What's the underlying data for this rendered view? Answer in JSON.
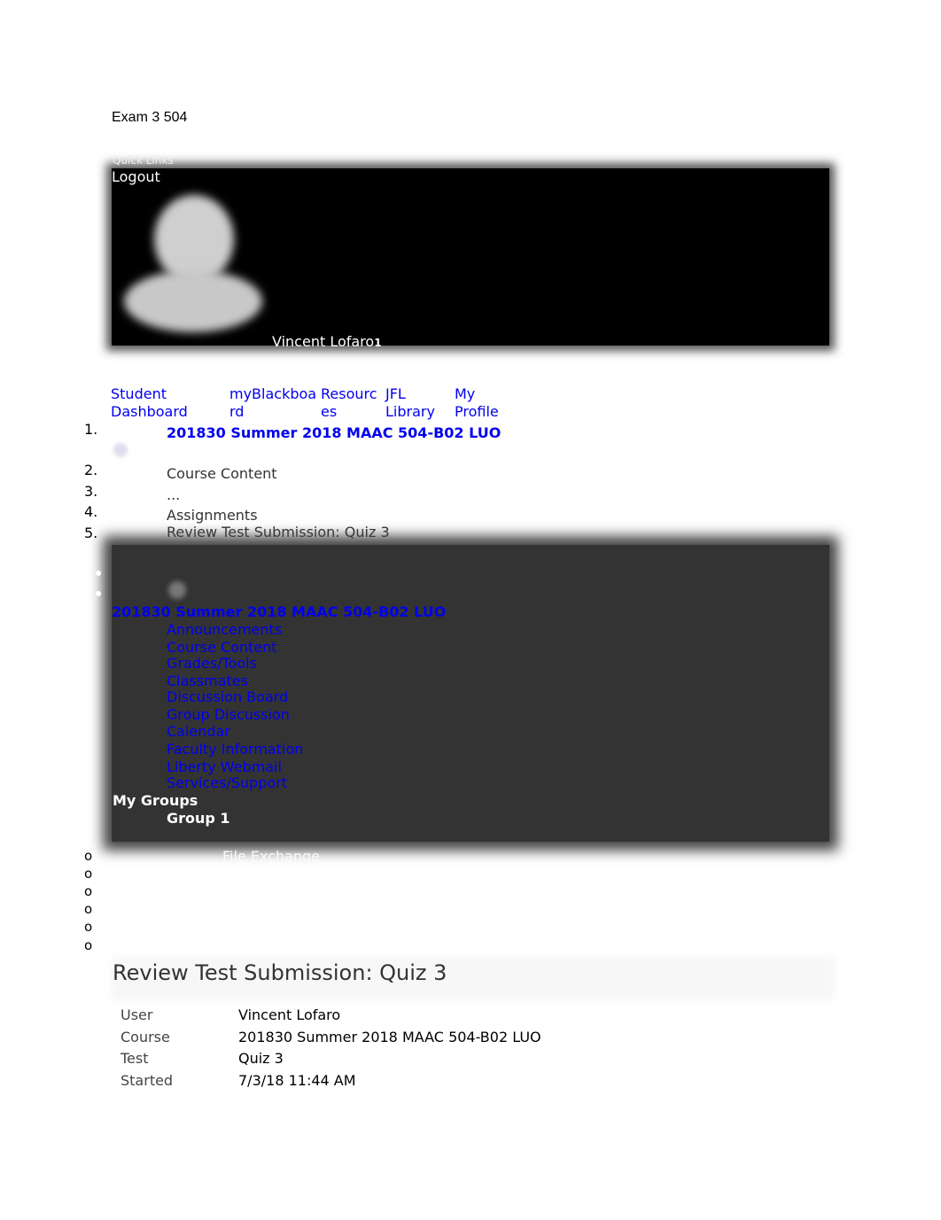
{
  "doc_title": "Exam 3 504",
  "header": {
    "quick_links": "Quick Links",
    "logout": "Logout",
    "user_name": "Vincent Lofaro",
    "notification_count": "1"
  },
  "nav_tabs": [
    {
      "line1": "Student",
      "line2": "Dashboard"
    },
    {
      "line1": "myBlackboa",
      "line2": "rd"
    },
    {
      "line1": "Resourc",
      "line2": "es"
    },
    {
      "line1": "JFL",
      "line2": "Library"
    },
    {
      "line1": "My",
      "line2": "Profile"
    }
  ],
  "breadcrumb": {
    "numbers": [
      "1.",
      "2.",
      "3.",
      "4.",
      "5."
    ],
    "items": [
      "201830 Summer 2018 MAAC 504-B02 LUO",
      "Course Content",
      "...",
      "Assignments",
      "Review Test Submission: Quiz 3"
    ]
  },
  "course_menu": {
    "course_title": "201830 Summer 2018 MAAC 504-B02 LUO",
    "items": [
      "Announcements",
      "Course Content",
      "Grades/Tools",
      "Classmates",
      "Discussion Board",
      "Group Discussion",
      "Calendar",
      "Faculty Information",
      "Liberty Webmail",
      "Services/Support"
    ],
    "groups_heading": "My Groups",
    "group": "Group 1",
    "group_tool": "File Exchange",
    "sub_marker": "o"
  },
  "page_title": "Review Test Submission: Quiz 3",
  "details": [
    {
      "label": "User",
      "value": "Vincent Lofaro"
    },
    {
      "label": "Course",
      "value": "201830 Summer 2018 MAAC 504-B02 LUO"
    },
    {
      "label": "Test",
      "value": "Quiz 3"
    },
    {
      "label": "Started",
      "value": "7/3/18 11:44 AM"
    }
  ]
}
